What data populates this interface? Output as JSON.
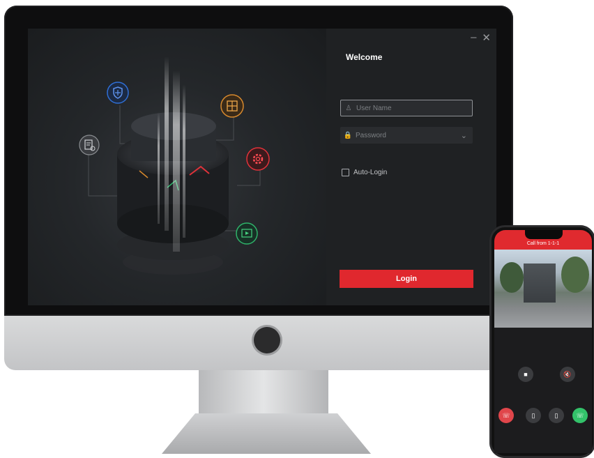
{
  "window": {
    "minimize_glyph": "–",
    "close_glyph": "✕"
  },
  "login": {
    "title": "Welcome",
    "username_placeholder": "User Name",
    "password_placeholder": "Password",
    "auto_login_label": "Auto-Login",
    "login_button": "Login"
  },
  "phone": {
    "call_title": "Call from 1-1-1"
  },
  "icons": {
    "feature_icons": [
      "shield-icon",
      "grid-icon",
      "gear-icon",
      "alarm-doc-icon",
      "playback-icon"
    ],
    "user": "user-icon",
    "lock": "lock-icon",
    "chevron": "chevron-down-icon"
  },
  "colors": {
    "accent_red": "#e0282e",
    "shield_blue": "#2f6fd6",
    "grid_orange": "#d7892d",
    "gear_red": "#e0323a",
    "play_green": "#2fb36a",
    "answer_green": "#33c26a"
  }
}
